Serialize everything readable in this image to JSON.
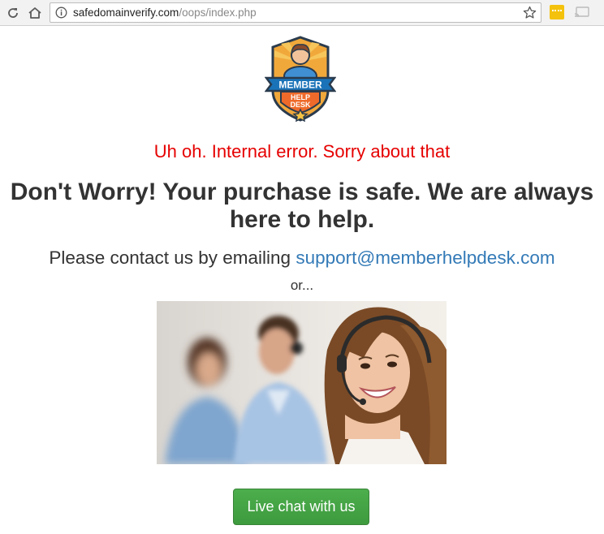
{
  "browser": {
    "url_host": "safedomainverify.com",
    "url_path": "/oops/index.php"
  },
  "logo": {
    "line1": "MEMBER",
    "line2": "HELP",
    "line3": "DESK"
  },
  "content": {
    "error_message": "Uh oh. Internal error. Sorry about that",
    "headline": "Don't Worry! Your purchase is safe. We are always here to help.",
    "contact_prefix": "Please contact us by emailing",
    "contact_email": "support@memberhelpdesk.com",
    "or_text": "or...",
    "chat_button_label": "Live chat with us"
  },
  "colors": {
    "error": "#e60000",
    "link": "#337ab7",
    "button": "#449d44"
  },
  "icons": [
    "reload-icon",
    "home-icon",
    "info-icon",
    "star-icon",
    "extension-icon",
    "cast-icon"
  ]
}
